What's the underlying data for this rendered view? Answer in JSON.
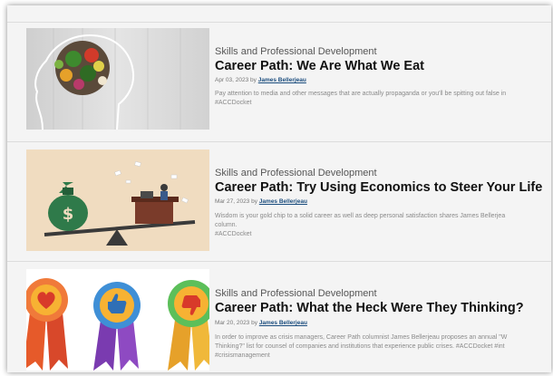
{
  "articles": [
    {
      "category": "Skills and Professional Development",
      "title": "Career Path: We Are What We Eat",
      "date": "Apr 03, 2023",
      "by": "by",
      "author": "James Bellerjeau",
      "excerpt_lines": [
        "Pay attention to media and other messages that are actually propaganda or you'll be spitting out false in",
        "#ACCDocket"
      ],
      "image": "head-with-food-image"
    },
    {
      "category": "Skills and Professional Development",
      "title": "Career Path: Try Using Economics to Steer Your Life",
      "date": "Mar 27, 2023",
      "by": "by",
      "author": "James Bellerjeau",
      "excerpt_lines": [
        "Wisdom is your gold chip to a solid career as well as deep personal satisfaction shares James Bellerjea",
        "column.",
        "#ACCDocket"
      ],
      "image": "money-bag-seesaw-image"
    },
    {
      "category": "Skills and Professional Development",
      "title": "Career Path: What the Heck Were They Thinking?",
      "date": "Mar 20, 2023",
      "by": "by",
      "author": "James Bellerjeau",
      "excerpt_lines": [
        "In order to improve as crisis managers, Career Path columnist James Bellerjeau proposes an annual \"W",
        "Thinking?\" list for counsel of companies and institutions that experience public crises. #ACCDocket #int",
        "#crisismanagement"
      ],
      "image": "award-ribbons-image"
    }
  ],
  "colors": {
    "heart_ribbon": "#f07a3a",
    "thumbs_up_ribbon": "#3f8fd6",
    "thumbs_down_ribbon": "#5cbf5a",
    "money_bag": "#2f7a4a",
    "desk": "#7a3b2a",
    "seesaw_bg": "#f0dcc0"
  }
}
